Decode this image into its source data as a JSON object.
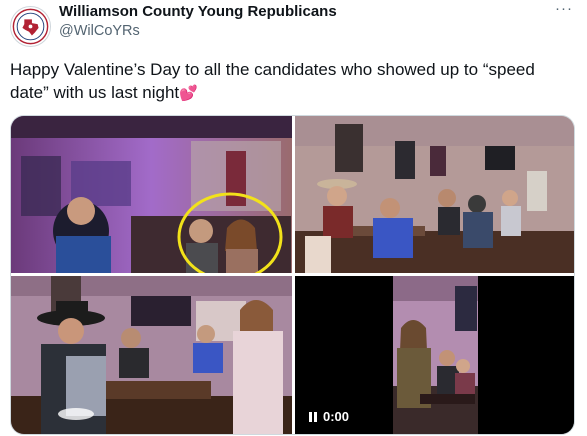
{
  "account": {
    "name": "Williamson County Young Republicans",
    "handle": "@WilCoYRs"
  },
  "more_label": "···",
  "tweet": {
    "text": "Happy Valentine’s Day to all the candidates who showed up to “speed date” with us last night",
    "emoji": "💕"
  },
  "media": {
    "photos": [
      {
        "icon": "photo-speed-dating-bar-highlighted-couple"
      },
      {
        "icon": "photo-cowboy-hat-tables-row"
      },
      {
        "icon": "photo-cowboy-and-woman-talking"
      }
    ],
    "video": {
      "time": "0:00",
      "state": "paused"
    }
  },
  "colors": {
    "highlight_circle": "#f2e21a",
    "purple_light": "#9a63c8",
    "handle_text": "#536471"
  }
}
